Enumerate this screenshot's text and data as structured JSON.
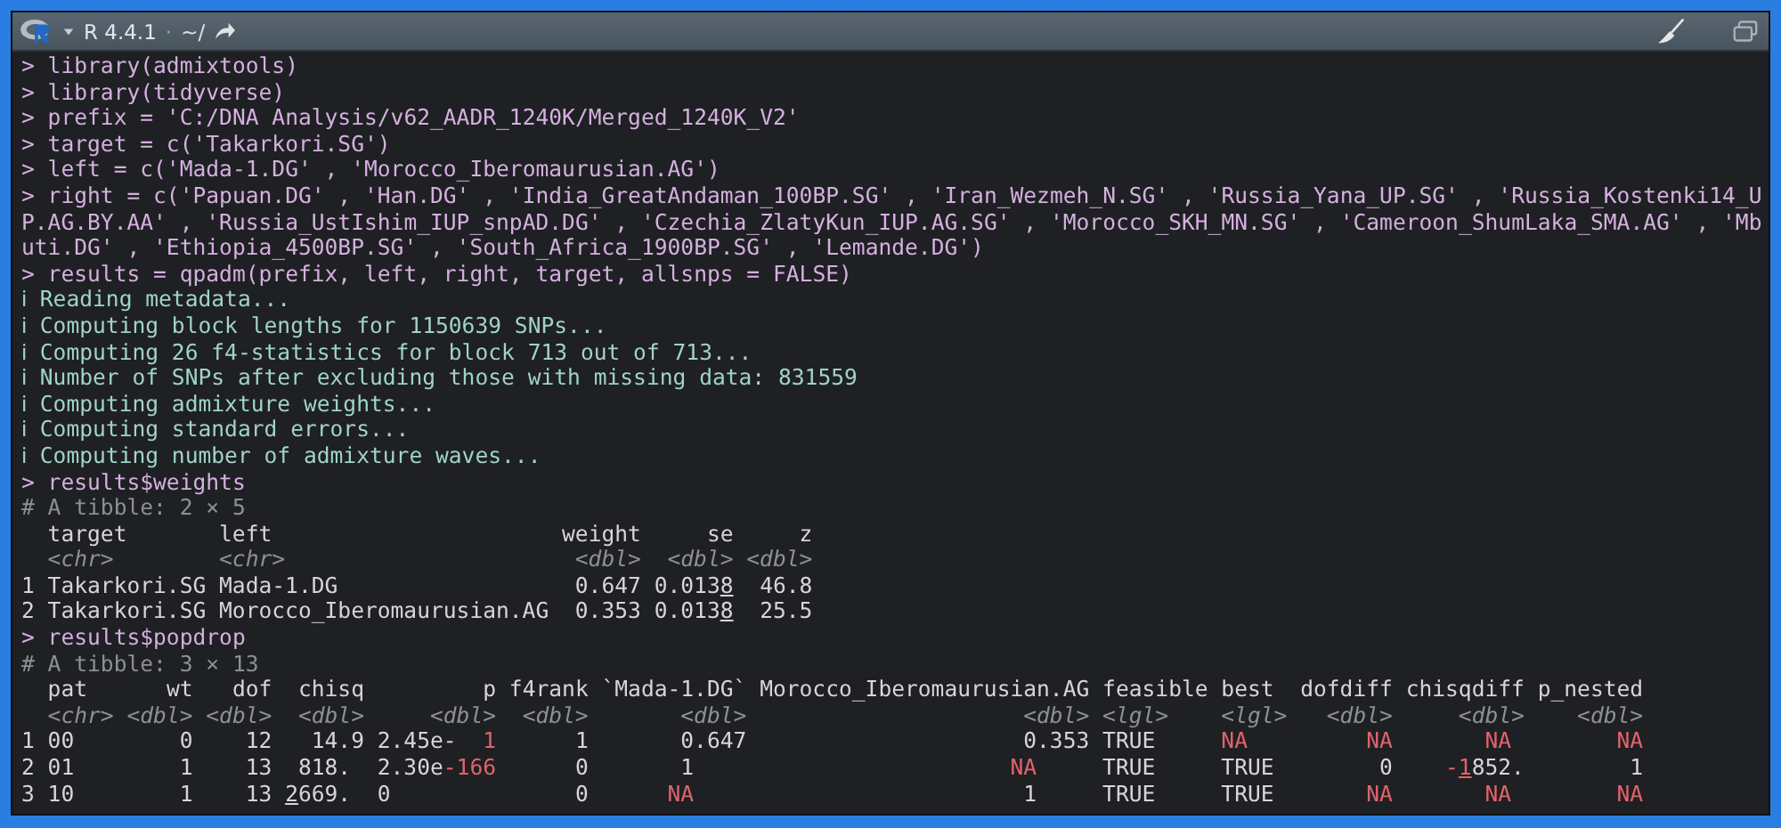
{
  "title_bar": {
    "version": "R 4.4.1",
    "separator": "·",
    "path": "~/"
  },
  "console": {
    "lines": [
      {
        "kind": "input",
        "text": "> library(admixtools)"
      },
      {
        "kind": "input",
        "text": "> library(tidyverse)"
      },
      {
        "kind": "input",
        "text": "> prefix = 'C:/DNA Analysis/v62_AADR_1240K/Merged_1240K_V2'"
      },
      {
        "kind": "input",
        "text": "> target = c('Takarkori.SG')"
      },
      {
        "kind": "input",
        "text": "> left = c('Mada-1.DG' , 'Morocco_Iberomaurusian.AG')"
      },
      {
        "kind": "input",
        "text": "> right = c('Papuan.DG' , 'Han.DG' , 'India_GreatAndaman_100BP.SG' , 'Iran_Wezmeh_N.SG' , 'Russia_Yana_UP.SG' , 'Russia_Kostenki14_U"
      },
      {
        "kind": "input",
        "text": "P.AG.BY.AA' , 'Russia_UstIshim_IUP_snpAD.DG' , 'Czechia_ZlatyKun_IUP.AG.SG' , 'Morocco_SKH_MN.SG' , 'Cameroon_ShumLaka_SMA.AG' , 'Mb"
      },
      {
        "kind": "input",
        "text": "uti.DG' , 'Ethiopia_4500BP.SG' , 'South_Africa_1900BP.SG' , 'Lemande.DG')"
      },
      {
        "kind": "input",
        "text": "> results = qpadm(prefix, left, right, target, allsnps = FALSE)"
      },
      {
        "kind": "info",
        "text": "ℹ Reading metadata..."
      },
      {
        "kind": "info",
        "text": "ℹ Computing block lengths for 1150639 SNPs..."
      },
      {
        "kind": "info",
        "text": "ℹ Computing 26 f4-statistics for block 713 out of 713..."
      },
      {
        "kind": "info",
        "text": "ℹ Number of SNPs after excluding those with missing data: 831559"
      },
      {
        "kind": "info",
        "text": "ℹ Computing admixture weights..."
      },
      {
        "kind": "info",
        "text": "ℹ Computing standard errors..."
      },
      {
        "kind": "info",
        "text": "ℹ Computing number of admixture waves..."
      },
      {
        "kind": "input",
        "text": "> results$weights"
      },
      {
        "kind": "comment",
        "text": "# A tibble: 2 × 5"
      },
      {
        "kind": "table",
        "columns": [
          {
            "header": "target",
            "type": "<chr>"
          },
          {
            "header": "left",
            "type": "<chr>"
          },
          {
            "header": "weight",
            "type": "<dbl>"
          },
          {
            "header": "se",
            "type": "<dbl>"
          },
          {
            "header": "z",
            "type": "<dbl>"
          }
        ],
        "rows": [
          {
            "index": "1",
            "cells": [
              "Takarkori.SG",
              "Mada-1.DG",
              "0.647",
              {
                "parts": [
                  {
                    "text": "0.013",
                    "flagged": false,
                    "underlined": false
                  },
                  {
                    "text": "8",
                    "flagged": false,
                    "underlined": true
                  }
                ]
              },
              "46.8"
            ]
          },
          {
            "index": "2",
            "cells": [
              "Takarkori.SG",
              "Morocco_Iberomaurusian.AG",
              "0.353",
              {
                "parts": [
                  {
                    "text": "0.013",
                    "flagged": false,
                    "underlined": false
                  },
                  {
                    "text": "8",
                    "flagged": false,
                    "underlined": true
                  }
                ]
              },
              "25.5"
            ]
          }
        ]
      },
      {
        "kind": "input",
        "text": "> results$popdrop"
      },
      {
        "kind": "comment",
        "text": "# A tibble: 3 × 13"
      },
      {
        "kind": "table",
        "columns": [
          {
            "header": "pat",
            "type": "<chr>"
          },
          {
            "header": "wt",
            "type": "<dbl>"
          },
          {
            "header": "dof",
            "type": "<dbl>"
          },
          {
            "header": "chisq",
            "type": "<dbl>"
          },
          {
            "header": "p",
            "type": "<dbl>"
          },
          {
            "header": "f4rank",
            "type": "<dbl>"
          },
          {
            "header": "`Mada-1.DG`",
            "type": "<dbl>"
          },
          {
            "header": "Morocco_Iberomaurusian.AG",
            "type": "<dbl>"
          },
          {
            "header": "feasible",
            "type": "<lgl>"
          },
          {
            "header": "best",
            "type": "<lgl>"
          },
          {
            "header": "dofdiff",
            "type": "<dbl>"
          },
          {
            "header": "chisqdiff",
            "type": "<dbl>"
          },
          {
            "header": "p_nested",
            "type": "<dbl>"
          }
        ],
        "rows": [
          {
            "index": "1",
            "cells": [
              "00",
              "0",
              "12",
              "14.9",
              {
                "parts": [
                  {
                    "text": "2.45e-",
                    "flagged": false,
                    "underlined": false
                  },
                  {
                    "text": "  1",
                    "flagged": true,
                    "underlined": false
                  }
                ]
              },
              "1",
              "0.647",
              "0.353",
              "TRUE",
              {
                "parts": [
                  {
                    "text": "NA",
                    "flagged": true,
                    "underlined": false
                  }
                ]
              },
              {
                "parts": [
                  {
                    "text": "NA",
                    "flagged": true,
                    "underlined": false
                  }
                ]
              },
              {
                "parts": [
                  {
                    "text": "NA",
                    "flagged": true,
                    "underlined": false
                  }
                ]
              },
              {
                "parts": [
                  {
                    "text": "NA",
                    "flagged": true,
                    "underlined": false
                  }
                ]
              }
            ]
          },
          {
            "index": "2",
            "cells": [
              "01",
              "1",
              "13",
              "818.",
              {
                "parts": [
                  {
                    "text": "2.30e",
                    "flagged": false,
                    "underlined": false
                  },
                  {
                    "text": "-166",
                    "flagged": true,
                    "underlined": false
                  }
                ]
              },
              "0",
              "1",
              {
                "parts": [
                  {
                    "text": "NA",
                    "flagged": true,
                    "underlined": false
                  }
                ]
              },
              "TRUE",
              "TRUE",
              "0",
              {
                "parts": [
                  {
                    "text": "-",
                    "flagged": true,
                    "underlined": false
                  },
                  {
                    "text": "1",
                    "flagged": true,
                    "underlined": true
                  },
                  {
                    "text": "852.",
                    "flagged": false,
                    "underlined": false
                  }
                ]
              },
              "1"
            ]
          },
          {
            "index": "3",
            "cells": [
              "10",
              "1",
              "13",
              {
                "parts": [
                  {
                    "text": "2",
                    "flagged": false,
                    "underlined": true
                  },
                  {
                    "text": "669.",
                    "flagged": false,
                    "underlined": false
                  }
                ]
              },
              "0",
              "0",
              {
                "parts": [
                  {
                    "text": "NA",
                    "flagged": true,
                    "underlined": false
                  }
                ]
              },
              "1",
              "TRUE",
              "TRUE",
              {
                "parts": [
                  {
                    "text": "NA",
                    "flagged": true,
                    "underlined": false
                  }
                ]
              },
              {
                "parts": [
                  {
                    "text": "NA",
                    "flagged": true,
                    "underlined": false
                  }
                ]
              },
              {
                "parts": [
                  {
                    "text": "NA",
                    "flagged": true,
                    "underlined": false
                  }
                ]
              }
            ]
          }
        ]
      }
    ]
  }
}
